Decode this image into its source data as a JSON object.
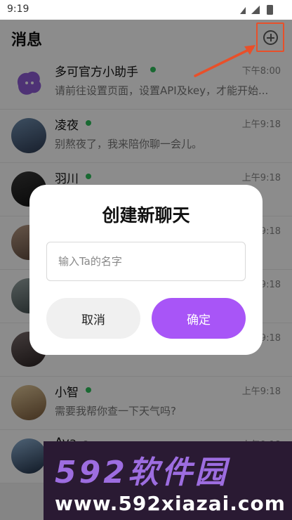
{
  "status_bar": {
    "time": "9:19"
  },
  "header": {
    "title": "消息",
    "add_icon": "plus-circle-icon"
  },
  "chats": [
    {
      "name": "多可官方小助手",
      "online": true,
      "time": "下午8:00",
      "preview": "请前往设置页面，设置API及key，才能开始..."
    },
    {
      "name": "凌夜",
      "online": true,
      "time": "上午9:18",
      "preview": "别熬夜了，我来陪你聊一会儿。"
    },
    {
      "name": "羽川",
      "online": true,
      "time": "上午9:18",
      "preview": ""
    },
    {
      "name": "",
      "online": false,
      "time": "上午9:18",
      "preview": ""
    },
    {
      "name": "",
      "online": false,
      "time": "上午9:18",
      "preview": ""
    },
    {
      "name": "",
      "online": false,
      "time": "上午9:18",
      "preview": ""
    },
    {
      "name": "小智",
      "online": true,
      "time": "上午9:18",
      "preview": "需要我帮你查一下天气吗?"
    },
    {
      "name": "Ava",
      "online": false,
      "time": "上午9:18",
      "preview": ""
    }
  ],
  "modal": {
    "title": "创建新聊天",
    "input_placeholder": "输入Ta的名字",
    "input_value": "",
    "cancel_label": "取消",
    "confirm_label": "确定"
  },
  "watermark": {
    "logo": "592软件园",
    "url": "www.592xiazai.com"
  },
  "colors": {
    "accent": "#a855f7",
    "online": "#2fbf5b",
    "annotation": "#e8502a"
  }
}
